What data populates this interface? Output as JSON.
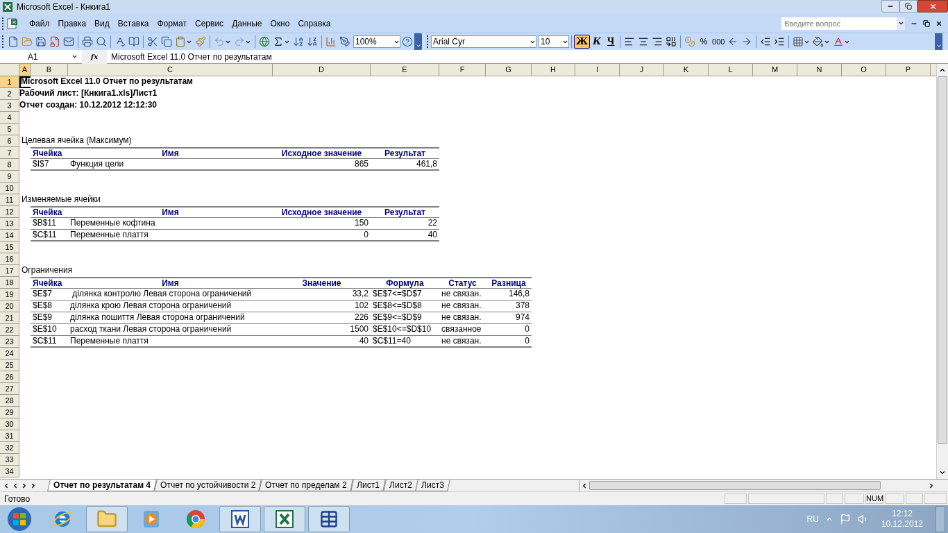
{
  "window": {
    "title": "Microsoft Excel - Кнкига1"
  },
  "menu": [
    "Файл",
    "Правка",
    "Вид",
    "Вставка",
    "Формат",
    "Сервис",
    "Данные",
    "Окно",
    "Справка"
  ],
  "help_box": {
    "placeholder": "Введите вопрос"
  },
  "toolbar": {
    "zoom": "100%",
    "font": "Arial Cyr",
    "font_size": "10",
    "bold": {
      "label": "Ж",
      "selected": true
    },
    "italic": {
      "label": "К",
      "selected": false
    },
    "underline": {
      "label": "Ч",
      "selected": false
    },
    "percent": "%",
    "thousands": "000"
  },
  "formula_bar": {
    "name_box": "A1",
    "fx": "fx",
    "content": "Microsoft Excel 11.0 Отчет по результатам"
  },
  "sheet": {
    "columns": [
      {
        "label": "A",
        "selected": true
      },
      {
        "label": "B",
        "selected": false
      },
      {
        "label": "C",
        "selected": false
      },
      {
        "label": "D",
        "selected": false
      },
      {
        "label": "E",
        "selected": false
      },
      {
        "label": "F",
        "selected": false
      },
      {
        "label": "G",
        "selected": false
      },
      {
        "label": "H",
        "selected": false
      },
      {
        "label": "I",
        "selected": false
      },
      {
        "label": "J",
        "selected": false
      },
      {
        "label": "K",
        "selected": false
      },
      {
        "label": "L",
        "selected": false
      },
      {
        "label": "M",
        "selected": false
      },
      {
        "label": "N",
        "selected": false
      },
      {
        "label": "O",
        "selected": false
      },
      {
        "label": "P",
        "selected": false
      }
    ],
    "rows": [
      {
        "label": "1",
        "selected": true,
        "kind": "plain",
        "cells": [
          {
            "kind": "title",
            "text": "Microsoft Excel 11.0 Отчет по результатам"
          }
        ]
      },
      {
        "label": "2",
        "selected": false,
        "kind": "plain",
        "cells": [
          {
            "kind": "title",
            "text": "Рабочий лист: [Кнкига1.xls]Лист1"
          }
        ]
      },
      {
        "label": "3",
        "selected": false,
        "kind": "plain",
        "cells": [
          {
            "kind": "title",
            "text": "Отчет создан: 10.12.2012 12:12:30"
          }
        ]
      },
      {
        "label": "4",
        "selected": false,
        "kind": "plain",
        "cells": []
      },
      {
        "label": "5",
        "selected": false,
        "kind": "plain",
        "cells": []
      },
      {
        "label": "6",
        "selected": false,
        "kind": "plain",
        "cells": [
          {
            "kind": "text",
            "text": "Целевая ячейка (Максимум)"
          }
        ]
      },
      {
        "label": "7",
        "selected": false,
        "kind": "table_header",
        "cells": [
          {},
          {
            "kind": "header_left",
            "text": "Ячейка"
          },
          {
            "kind": "header",
            "text": "Имя"
          },
          {
            "kind": "header",
            "text": "Исходное значение"
          },
          {
            "kind": "header",
            "text": "Результат"
          }
        ]
      },
      {
        "label": "8",
        "selected": false,
        "kind": "table_last",
        "cells": [
          {},
          {
            "kind": "text",
            "text": "$I$7"
          },
          {
            "kind": "text",
            "text": "Функция цели"
          },
          {
            "kind": "number",
            "text": "865"
          },
          {
            "kind": "number",
            "text": "461,8"
          }
        ]
      },
      {
        "label": "9",
        "selected": false,
        "kind": "plain",
        "cells": []
      },
      {
        "label": "10",
        "selected": false,
        "kind": "plain",
        "cells": []
      },
      {
        "label": "11",
        "selected": false,
        "kind": "plain",
        "cells": [
          {
            "kind": "text",
            "text": "Изменяемые ячейки"
          }
        ]
      },
      {
        "label": "12",
        "selected": false,
        "kind": "table_header",
        "cells": [
          {},
          {
            "kind": "header_left",
            "text": "Ячейка"
          },
          {
            "kind": "header",
            "text": "Имя"
          },
          {
            "kind": "header",
            "text": "Исходное значение"
          },
          {
            "kind": "header",
            "text": "Результат"
          }
        ]
      },
      {
        "label": "13",
        "selected": false,
        "kind": "table_row",
        "cells": [
          {},
          {
            "kind": "text",
            "text": "$B$11"
          },
          {
            "kind": "text",
            "text": "Переменные кофтина"
          },
          {
            "kind": "number",
            "text": "150"
          },
          {
            "kind": "number",
            "text": "22"
          }
        ]
      },
      {
        "label": "14",
        "selected": false,
        "kind": "table_last",
        "cells": [
          {},
          {
            "kind": "text",
            "text": "$C$11"
          },
          {
            "kind": "text",
            "text": "Переменные плаття"
          },
          {
            "kind": "number",
            "text": "0"
          },
          {
            "kind": "number",
            "text": "40"
          }
        ]
      },
      {
        "label": "15",
        "selected": false,
        "kind": "plain",
        "cells": []
      },
      {
        "label": "16",
        "selected": false,
        "kind": "plain",
        "cells": []
      },
      {
        "label": "17",
        "selected": false,
        "kind": "plain",
        "cells": [
          {
            "kind": "text",
            "text": "Ограничения"
          }
        ]
      },
      {
        "label": "18",
        "selected": false,
        "kind": "table_header",
        "cells": [
          {},
          {
            "kind": "header_left",
            "text": "Ячейка"
          },
          {
            "kind": "header",
            "text": "Имя"
          },
          {
            "kind": "header",
            "text": "Значение"
          },
          {
            "kind": "header",
            "text": "Формула"
          },
          {
            "kind": "header",
            "text": "Статус"
          },
          {
            "kind": "header",
            "text": "Разница"
          }
        ]
      },
      {
        "label": "19",
        "selected": false,
        "kind": "table_row",
        "cells": [
          {},
          {
            "kind": "text",
            "text": "$E$7"
          },
          {
            "kind": "text",
            "text": " ділянка контролю Левая сторона ограничений"
          },
          {
            "kind": "number",
            "text": "33,2"
          },
          {
            "kind": "text",
            "text": "$E$7<=$D$7"
          },
          {
            "kind": "text",
            "text": "не связан."
          },
          {
            "kind": "number",
            "text": "146,8"
          }
        ]
      },
      {
        "label": "20",
        "selected": false,
        "kind": "table_row",
        "cells": [
          {},
          {
            "kind": "text",
            "text": "$E$8"
          },
          {
            "kind": "text",
            "text": "ділянка крою Левая сторона ограничений"
          },
          {
            "kind": "number",
            "text": "102"
          },
          {
            "kind": "text",
            "text": "$E$8<=$D$8"
          },
          {
            "kind": "text",
            "text": "не связан."
          },
          {
            "kind": "number",
            "text": "378"
          }
        ]
      },
      {
        "label": "21",
        "selected": false,
        "kind": "table_row",
        "cells": [
          {},
          {
            "kind": "text",
            "text": "$E$9"
          },
          {
            "kind": "text",
            "text": "ділянка пошиття Левая сторона ограничений"
          },
          {
            "kind": "number",
            "text": "226"
          },
          {
            "kind": "text",
            "text": "$E$9<=$D$9"
          },
          {
            "kind": "text",
            "text": "не связан."
          },
          {
            "kind": "number",
            "text": "974"
          }
        ]
      },
      {
        "label": "22",
        "selected": false,
        "kind": "table_row",
        "cells": [
          {},
          {
            "kind": "text",
            "text": "$E$10"
          },
          {
            "kind": "text",
            "text": "расход ткани Левая сторона ограничений"
          },
          {
            "kind": "number",
            "text": "1500"
          },
          {
            "kind": "text",
            "text": "$E$10<=$D$10"
          },
          {
            "kind": "text",
            "text": "связанное"
          },
          {
            "kind": "number",
            "text": "0"
          }
        ]
      },
      {
        "label": "23",
        "selected": false,
        "kind": "table_last",
        "cells": [
          {},
          {
            "kind": "text",
            "text": "$C$11"
          },
          {
            "kind": "text",
            "text": "Переменные плаття"
          },
          {
            "kind": "number",
            "text": "40"
          },
          {
            "kind": "text",
            "text": "$C$11=40"
          },
          {
            "kind": "text",
            "text": "не связан."
          },
          {
            "kind": "number",
            "text": "0"
          }
        ]
      },
      {
        "label": "24",
        "selected": false,
        "kind": "plain",
        "cells": []
      },
      {
        "label": "25",
        "selected": false,
        "kind": "plain",
        "cells": []
      },
      {
        "label": "26",
        "selected": false,
        "kind": "plain",
        "cells": []
      },
      {
        "label": "27",
        "selected": false,
        "kind": "plain",
        "cells": []
      },
      {
        "label": "28",
        "selected": false,
        "kind": "plain",
        "cells": []
      },
      {
        "label": "29",
        "selected": false,
        "kind": "plain",
        "cells": []
      },
      {
        "label": "30",
        "selected": false,
        "kind": "plain",
        "cells": []
      },
      {
        "label": "31",
        "selected": false,
        "kind": "plain",
        "cells": []
      },
      {
        "label": "32",
        "selected": false,
        "kind": "plain",
        "cells": []
      },
      {
        "label": "33",
        "selected": false,
        "kind": "plain",
        "cells": []
      },
      {
        "label": "34",
        "selected": false,
        "kind": "plain",
        "cells": []
      }
    ]
  },
  "sheet_tabs": [
    {
      "label": "Отчет по результатам 4",
      "selected": true
    },
    {
      "label": "Отчет по устойчивости 2",
      "selected": false
    },
    {
      "label": "Отчет по пределам 2",
      "selected": false
    },
    {
      "label": "Лист1",
      "selected": false
    },
    {
      "label": "Лист2",
      "selected": false
    },
    {
      "label": "Лист3",
      "selected": false
    }
  ],
  "status_bar": {
    "text": "Готово",
    "indicators": [
      "NUM"
    ]
  },
  "taskbar": {
    "apps": [
      {
        "kind": "browser_e",
        "running": false
      },
      {
        "kind": "folder",
        "running": true
      },
      {
        "kind": "media",
        "running": false
      },
      {
        "kind": "browser_c",
        "running": false
      },
      {
        "kind": "word",
        "running": true
      },
      {
        "kind": "excel",
        "running": true
      },
      {
        "kind": "tool",
        "running": true
      }
    ],
    "tray": {
      "language": "RU",
      "time": "12:12",
      "date": "10.12.2012"
    }
  }
}
